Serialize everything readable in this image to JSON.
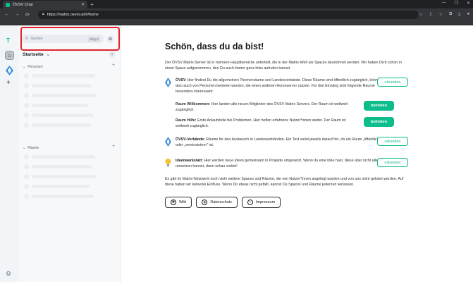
{
  "browser": {
    "tab_title": "ÖVSV Chat",
    "url": "https://matrix.oevsv.at/#/home"
  },
  "sidebar": {
    "space_initial": "T"
  },
  "roomlist": {
    "search_placeholder": "Suchen",
    "search_shortcut": "Strg K",
    "home_title": "Startseite",
    "people_label": "Personen",
    "rooms_label": "Räume"
  },
  "main": {
    "title": "Schön, dass du da bist!",
    "intro": "Der ÖVSV Matrix-Server ist in mehrere Hauptbereiche unterteilt, die in der Matrix-Welt als Spaces bezeichnet werden. Wir haben Dich schon in einen Space aufgenommen, den Du auch immer ganz links aufrufen kannst.",
    "oevsv_name": "ÖVSV",
    "oevsv_text": " Hier findest Du die allgemeinen Themenräume und Landesverbände. Diese Räume sind öffentlich zugänglich, können also auch von Personen betreten werden, die einen anderen Homeserver nutzen. Für den Einstieg sind folgende Räume besonders interessant:",
    "oevsv_button": "erkunden",
    "welcome_name": "Raum Willkommen:",
    "welcome_text": " Hier landen alle neuen Mitglieder des ÖVSV Matrix Servers. Der Raum ist weltweit zugänglich.",
    "welcome_button": "beitreten",
    "help_name": "Raum Hilfe:",
    "help_text": " Erste Anlaufstelle bei Problemen. Hier helfen erfahrene Nutzer*innen weiter. Der Raum ist weltweit zugänglich.",
    "help_button": "beitreten",
    "verbaende_name": "ÖVSV-Verbände:",
    "verbaende_text": " Räume für den Austausch in Landesverbänden. Ein Text weist jeweils darauf hin, ob ein Raum „öffentlich\" oder „vereinsintern\" ist.",
    "verbaende_button": "erkunden",
    "ideen_name": "Ideenwerkstatt:",
    "ideen_text": " Hier werden neue Ideen gemeinsam in Projekte umgesetzt. Wenn du eine Idee hast, diese aber nicht alleine umsetzen kannst, dann schau vorbei!",
    "ideen_button": "erkunden",
    "outro": "Es gibt im Matrix-Netzwerk noch viele weitere Spaces und Räume, die von Nutzer*innen angelegt wurden und von uns nicht gelistet werden. Auf diese haben wir keinerlei Einfluss. Wenn Dir etwas nicht gefällt, kannst Du Spaces und Räume jederzeit verlassen.",
    "footer": [
      "Wiki",
      "Datenschutz",
      "Impressum"
    ]
  }
}
